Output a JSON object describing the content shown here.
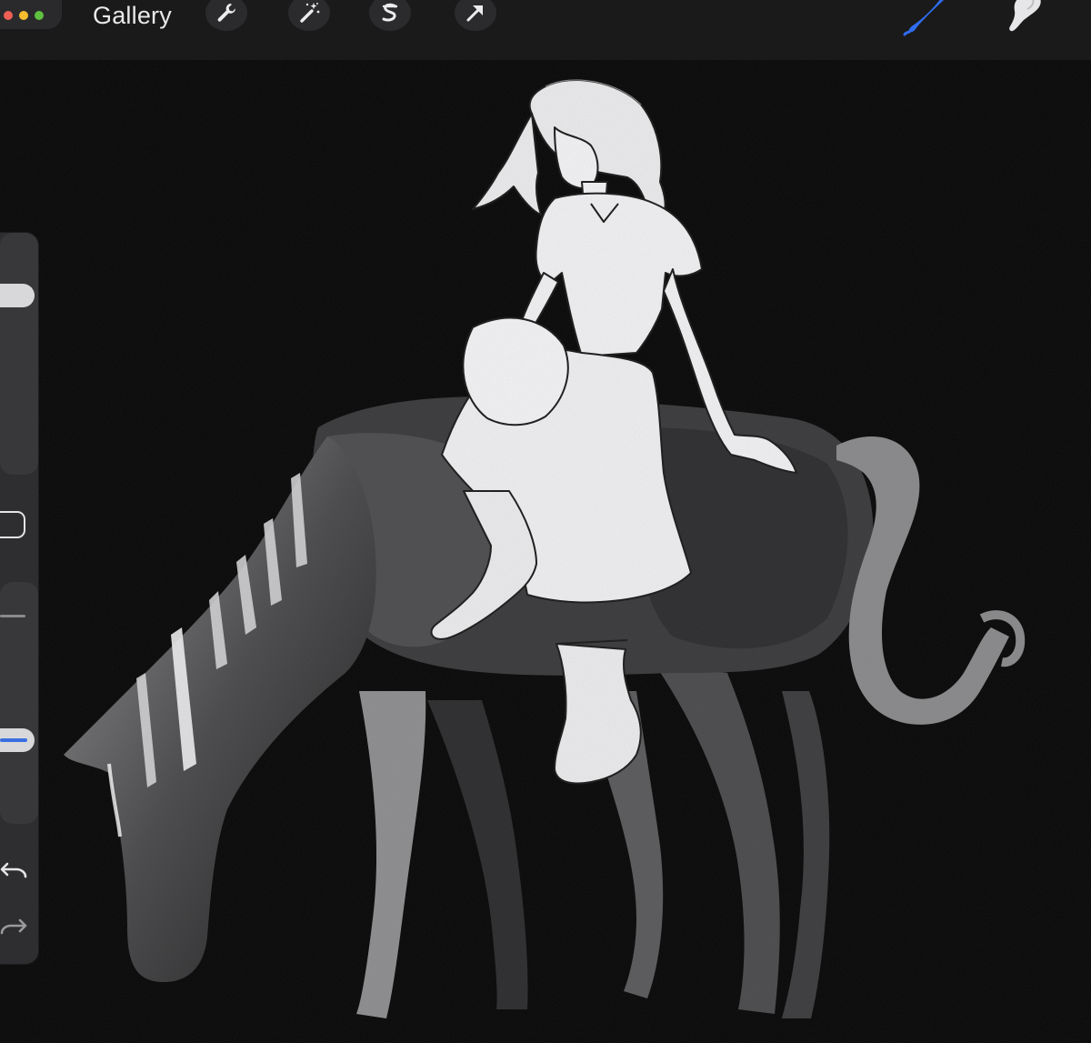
{
  "window": {
    "controls": [
      {
        "name": "close",
        "color": "#ee5f56"
      },
      {
        "name": "minimize",
        "color": "#f5bd2e"
      },
      {
        "name": "zoom",
        "color": "#5fc13f"
      }
    ]
  },
  "toolbar": {
    "gallery_label": "Gallery",
    "left_tools": [
      {
        "icon": "wrench-icon",
        "name": "actions"
      },
      {
        "icon": "magic-wand-icon",
        "name": "adjustments"
      },
      {
        "icon": "selection-s-icon",
        "name": "selection"
      },
      {
        "icon": "arrow-cursor-icon",
        "name": "transform"
      }
    ],
    "right_tools": [
      {
        "icon": "brush-icon",
        "name": "paint",
        "active": true,
        "color": "#2f6df0"
      },
      {
        "icon": "smudge-icon",
        "name": "smudge",
        "active": false
      }
    ]
  },
  "sidebar": {
    "brush_size": 0.78,
    "brush_opacity": 0.32,
    "icons": [
      "modify-square-icon",
      "undo-icon",
      "redo-icon"
    ]
  },
  "canvas": {
    "background": "#070707",
    "artwork_colors": {
      "horse": "#3a3a3c",
      "figure": "#eeeeee",
      "outline": "#1a1a1a"
    }
  }
}
